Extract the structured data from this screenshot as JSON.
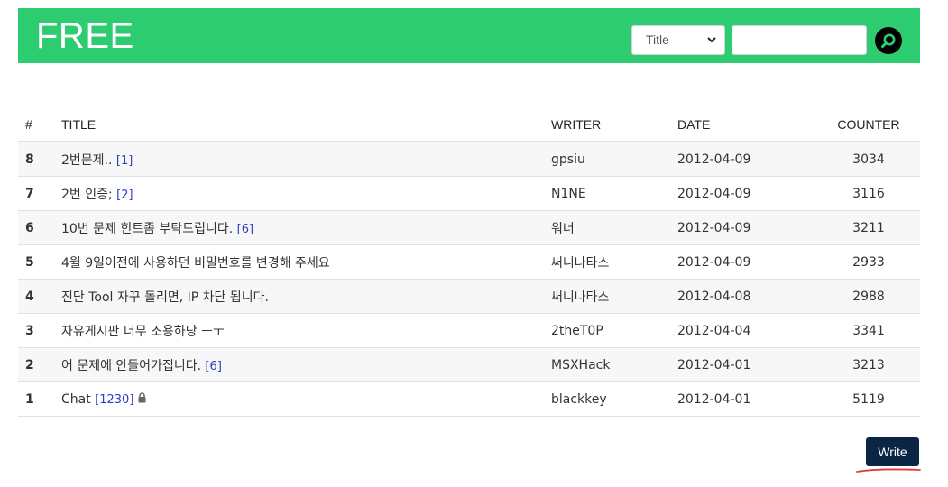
{
  "header": {
    "brand": "FREE",
    "search_select_value": "Title",
    "search_placeholder": "",
    "bg_color": "#2ecc71"
  },
  "table": {
    "columns": [
      "#",
      "TITLE",
      "WRITER",
      "DATE",
      "COUNTER"
    ],
    "rows": [
      {
        "num": "8",
        "title": "2번문제..",
        "comments": "[1]",
        "locked": false,
        "writer": "gpsiu",
        "date": "2012-04-09",
        "counter": "3034"
      },
      {
        "num": "7",
        "title": "2번 인증;",
        "comments": "[2]",
        "locked": false,
        "writer": "N1NE",
        "date": "2012-04-09",
        "counter": "3116"
      },
      {
        "num": "6",
        "title": "10번 문제 힌트좀 부탁드립니다.",
        "comments": "[6]",
        "locked": false,
        "writer": "워너",
        "date": "2012-04-09",
        "counter": "3211"
      },
      {
        "num": "5",
        "title": "4월 9일이전에 사용하던 비밀번호를 변경해 주세요",
        "comments": "",
        "locked": false,
        "writer": "써니나타스",
        "date": "2012-04-09",
        "counter": "2933"
      },
      {
        "num": "4",
        "title": "진단 Tool 자꾸 돌리면, IP 차단 됩니다.",
        "comments": "",
        "locked": false,
        "writer": "써니나타스",
        "date": "2012-04-08",
        "counter": "2988"
      },
      {
        "num": "3",
        "title": "자유게시판 너무 조용하당 ㅡㅜ",
        "comments": "",
        "locked": false,
        "writer": "2theT0P",
        "date": "2012-04-04",
        "counter": "3341"
      },
      {
        "num": "2",
        "title": "어 문제에 안들어가집니다.",
        "comments": "[6]",
        "locked": false,
        "writer": "MSXHack",
        "date": "2012-04-01",
        "counter": "3213"
      },
      {
        "num": "1",
        "title": "Chat",
        "comments": "[1230]",
        "locked": true,
        "writer": "blackkey",
        "date": "2012-04-01",
        "counter": "5119"
      }
    ]
  },
  "actions": {
    "write_label": "Write",
    "write_color": "#0b2545"
  },
  "icons": {
    "search": "search-icon",
    "lock": "lock-icon",
    "dropdown": "chevron-down-icon"
  }
}
